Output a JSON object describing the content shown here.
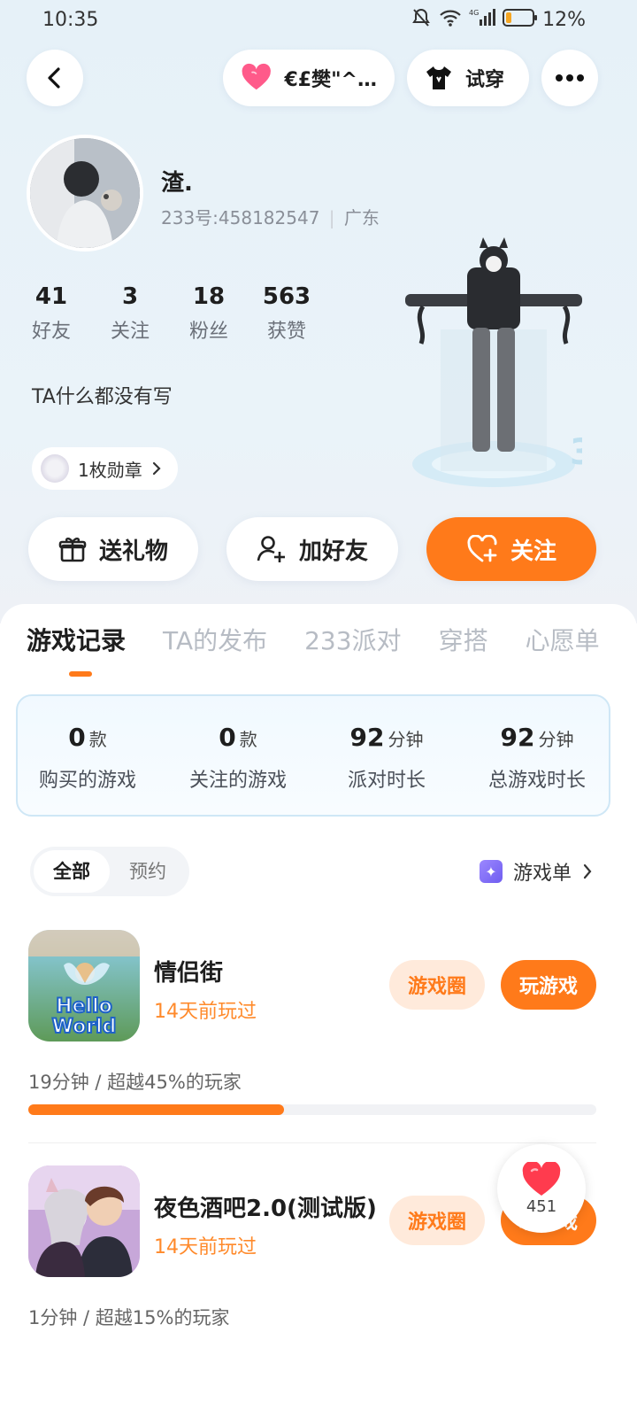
{
  "status_bar": {
    "time": "10:35",
    "battery": "12%"
  },
  "header": {
    "couple_label": "€£樊\"^…",
    "tryon_label": "试穿"
  },
  "profile": {
    "name": "渣.",
    "id_text": "233号:458182547",
    "region": "广东",
    "stats": [
      {
        "value": "41",
        "label": "好友"
      },
      {
        "value": "3",
        "label": "关注"
      },
      {
        "value": "18",
        "label": "粉丝"
      },
      {
        "value": "563",
        "label": "获赞"
      }
    ],
    "bio": "TA什么都没有写",
    "badge_label": "1枚勋章"
  },
  "actions": {
    "gift": "送礼物",
    "add_friend": "加好友",
    "follow": "关注"
  },
  "tabs": [
    "游戏记录",
    "TA的发布",
    "233派对",
    "穿搭",
    "心愿单"
  ],
  "game_stats": [
    {
      "value": "0",
      "unit": "款",
      "label": "购买的游戏"
    },
    {
      "value": "0",
      "unit": "款",
      "label": "关注的游戏"
    },
    {
      "value": "92",
      "unit": "分钟",
      "label": "派对时长"
    },
    {
      "value": "92",
      "unit": "分钟",
      "label": "总游戏时长"
    }
  ],
  "filter": {
    "all": "全部",
    "reserve": "预约",
    "game_list": "游戏单"
  },
  "games": [
    {
      "title": "情侣街",
      "last_played": "14天前玩过",
      "circle_label": "游戏圈",
      "play_label": "玩游戏",
      "play_stat": "19分钟 / 超越45%的玩家",
      "progress": 0.45,
      "icon_text_1": "Hello",
      "icon_text_2": "World"
    },
    {
      "title": "夜色酒吧2.0(测试版)",
      "last_played": "14天前玩过",
      "circle_label": "游戏圈",
      "play_label": "玩游戏",
      "play_stat": "1分钟 / 超越15%的玩家"
    }
  ],
  "like_fab": {
    "count": "451"
  },
  "colors": {
    "accent": "#ff7a1a",
    "accent_light": "#ffeadb",
    "heart": "#ff3b4e"
  }
}
